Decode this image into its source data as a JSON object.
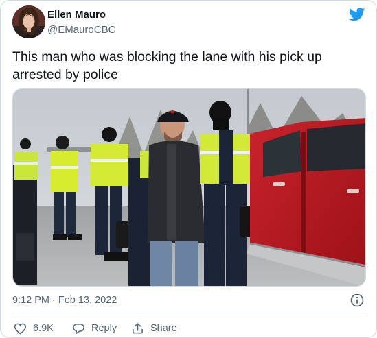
{
  "author": {
    "display_name": "Ellen Mauro",
    "handle": "@EMauroCBC",
    "avatar_icon": "author-avatar"
  },
  "tweet": {
    "text": "This man who was blocking the lane with his pick up arrested by police"
  },
  "media": {
    "kind": "photo"
  },
  "meta": {
    "timestamp": "9:12 PM · Feb 13, 2022"
  },
  "actions": {
    "like_count": "6.9K",
    "reply_label": "Reply",
    "share_label": "Share"
  },
  "colors": {
    "brand": "#1d9bf0",
    "secondary_text": "#536471",
    "border": "#cfd9de"
  },
  "icons": {
    "logo": "twitter-bird-icon",
    "info": "info-icon",
    "like": "heart-icon",
    "reply": "reply-bubble-icon",
    "share": "share-icon"
  }
}
